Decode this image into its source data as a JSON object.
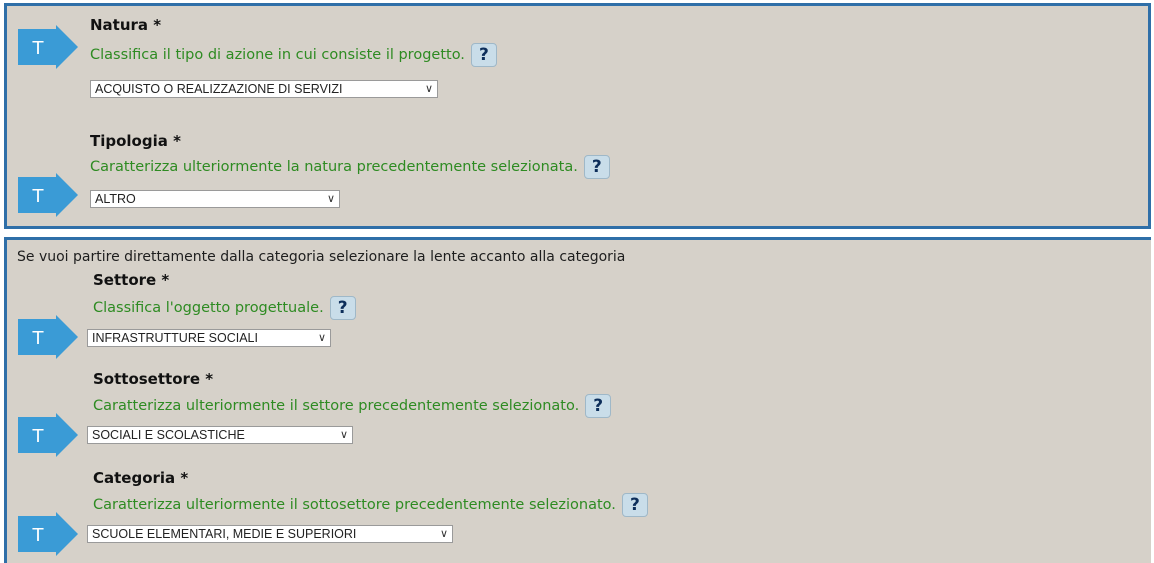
{
  "panel1": {
    "natura": {
      "title": "Natura *",
      "description": "Classifica il tipo di azione in cui consiste il progetto.",
      "help": "?",
      "selected": "ACQUISTO O REALIZZAZIONE DI SERVIZI"
    },
    "tipologia": {
      "title": "Tipologia *",
      "description": "Caratterizza ulteriormente la natura precedentemente selezionata.",
      "help": "?",
      "selected": "ALTRO"
    }
  },
  "panel2": {
    "note": "Se vuoi partire direttamente dalla categoria selezionare la lente accanto alla categoria",
    "settore": {
      "title": "Settore *",
      "description": "Classifica l'oggetto progettuale.",
      "help": "?",
      "selected": "INFRASTRUTTURE SOCIALI"
    },
    "sottosettore": {
      "title": "Sottosettore *",
      "description": "Caratterizza ulteriormente il settore precedentemente selezionato.",
      "help": "?",
      "selected": "SOCIALI E SCOLASTICHE"
    },
    "categoria": {
      "title": "Categoria *",
      "description": "Caratterizza ulteriormente il sottosettore precedentemente selezionato.",
      "help": "?",
      "selected": "SCUOLE ELEMENTARI, MEDIE E SUPERIORI"
    }
  },
  "icons": {
    "tarrow_letter": "T",
    "tarrow_color": "#3a9bd6",
    "help_color": "#c9dde9",
    "accent_green": "#2e8b22",
    "border_blue": "#2f6fa8"
  }
}
